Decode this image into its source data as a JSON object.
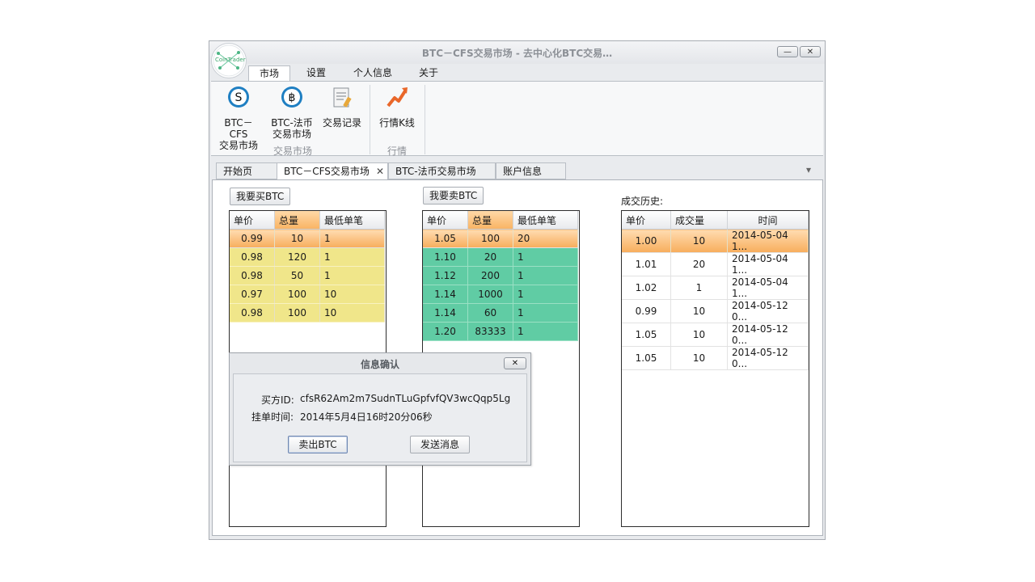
{
  "window": {
    "title": "BTC－CFS交易市场 - 去中心化BTC交易…",
    "logo_text": "CoinTrader",
    "minimize_glyph": "—",
    "close_glyph": "✕"
  },
  "menu_tabs": [
    {
      "label": "市场"
    },
    {
      "label": "设置"
    },
    {
      "label": "个人信息"
    },
    {
      "label": "关于"
    }
  ],
  "ribbon": {
    "groups": [
      {
        "label": "交易市场"
      },
      {
        "label": "行情"
      }
    ],
    "buttons": [
      {
        "line1": "BTC－CFS",
        "line2": "交易市场",
        "icon": "s-coin-icon"
      },
      {
        "line1": "BTC-法币",
        "line2": "交易市场",
        "icon": "bitcoin-icon"
      },
      {
        "line1": "交易记录",
        "line2": "",
        "icon": "document-icon"
      },
      {
        "line1": "行情K线",
        "line2": "",
        "icon": "trend-arrow-icon"
      }
    ]
  },
  "doc_tabs": [
    {
      "label": "开始页"
    },
    {
      "label": "BTC－CFS交易市场",
      "close": "✕"
    },
    {
      "label": "BTC-法币交易市场"
    },
    {
      "label": "账户信息"
    }
  ],
  "tab_dropdown_glyph": "▾",
  "buy": {
    "button_label": "我要买BTC",
    "columns": [
      "单价",
      "总量",
      "最低单笔"
    ],
    "rows": [
      [
        "0.99",
        "10",
        "1"
      ],
      [
        "0.98",
        "120",
        "1"
      ],
      [
        "0.98",
        "50",
        "1"
      ],
      [
        "0.97",
        "100",
        "10"
      ],
      [
        "0.98",
        "100",
        "10"
      ]
    ]
  },
  "sell": {
    "button_label": "我要卖BTC",
    "columns": [
      "单价",
      "总量",
      "最低单笔"
    ],
    "rows": [
      [
        "1.05",
        "100",
        "20"
      ],
      [
        "1.10",
        "20",
        "1"
      ],
      [
        "1.12",
        "200",
        "1"
      ],
      [
        "1.14",
        "1000",
        "1"
      ],
      [
        "1.14",
        "60",
        "1"
      ],
      [
        "1.20",
        "83333",
        "1"
      ]
    ]
  },
  "history": {
    "label": "成交历史:",
    "columns": [
      "单价",
      "成交量",
      "时间"
    ],
    "rows": [
      [
        "1.00",
        "10",
        "2014-05-04 1..."
      ],
      [
        "1.01",
        "20",
        "2014-05-04 1..."
      ],
      [
        "1.02",
        "1",
        "2014-05-04 1..."
      ],
      [
        "0.99",
        "10",
        "2014-05-12 0..."
      ],
      [
        "1.05",
        "10",
        "2014-05-12 0..."
      ],
      [
        "1.05",
        "10",
        "2014-05-12 0..."
      ]
    ]
  },
  "dialog": {
    "title": "信息确认",
    "close_glyph": "✕",
    "buyer_label": "买方ID:",
    "buyer_value": "cfsR62Am2m7SudnTLuGpfvfQV3wcQqp5Lg",
    "time_label": "挂单时间:",
    "time_value": "2014年5月4日16时20分06秒",
    "sell_button": "卖出BTC",
    "message_button": "发送消息"
  }
}
